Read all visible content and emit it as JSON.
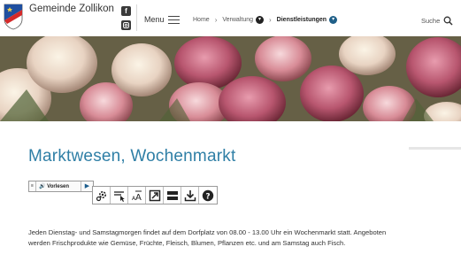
{
  "header": {
    "brand": "Gemeinde Zollikon",
    "menu_label": "Menu",
    "search_label": "Suche",
    "breadcrumb": [
      {
        "label": "Home"
      },
      {
        "label": "Verwaltung"
      },
      {
        "label": "Dienstleistungen"
      }
    ]
  },
  "social": {
    "facebook_icon": "f",
    "instagram_icon": "instagram-icon"
  },
  "page": {
    "title": "Marktwesen, Wochenmarkt",
    "intro": "Jeden Dienstag- und Samstagmorgen findet auf dem Dorfplatz von 08.00 - 13.00 Uhr ein Wochenmarkt statt. Angeboten werden Frischprodukte wie Gemüse, Früchte, Fleisch, Blumen, Pflanzen etc. und am Samstag auch Fisch."
  },
  "readspeaker": {
    "label": "Vorlesen",
    "tools": [
      "settings-icon",
      "text-select-icon",
      "text-size-icon",
      "popup-icon",
      "page-mask-icon",
      "download-icon",
      "help-icon"
    ]
  },
  "colors": {
    "title": "#2f7fa6",
    "accent_blue": "#1f5f88"
  }
}
